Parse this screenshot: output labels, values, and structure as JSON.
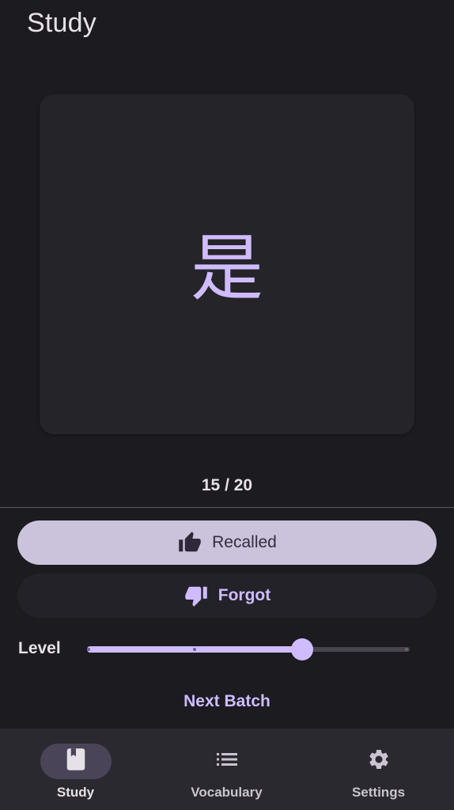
{
  "header": {
    "title": "Study"
  },
  "card": {
    "character": "是"
  },
  "progress": {
    "current": 15,
    "total": 20,
    "text": "15 / 20"
  },
  "actions": {
    "recalled_label": "Recalled",
    "recalled_icon": "thumb-up-icon",
    "forgot_label": "Forgot",
    "forgot_icon": "thumb-down-icon"
  },
  "level": {
    "label": "Level",
    "value_fraction": 0.667,
    "tick_fractions": [
      0,
      0.333,
      0.667,
      1.0
    ]
  },
  "next_batch_label": "Next Batch",
  "bottom_nav": {
    "items": [
      {
        "label": "Study",
        "icon": "book-icon",
        "active": true
      },
      {
        "label": "Vocabulary",
        "icon": "list-icon",
        "active": false
      },
      {
        "label": "Settings",
        "icon": "gear-icon",
        "active": false
      }
    ]
  },
  "colors": {
    "background": "#1c1b20",
    "card": "#252429",
    "accent": "#cfbcff",
    "recalled_button": "#cbc2db",
    "nav_background": "#2a2930",
    "nav_active_pill": "#4a4458"
  }
}
